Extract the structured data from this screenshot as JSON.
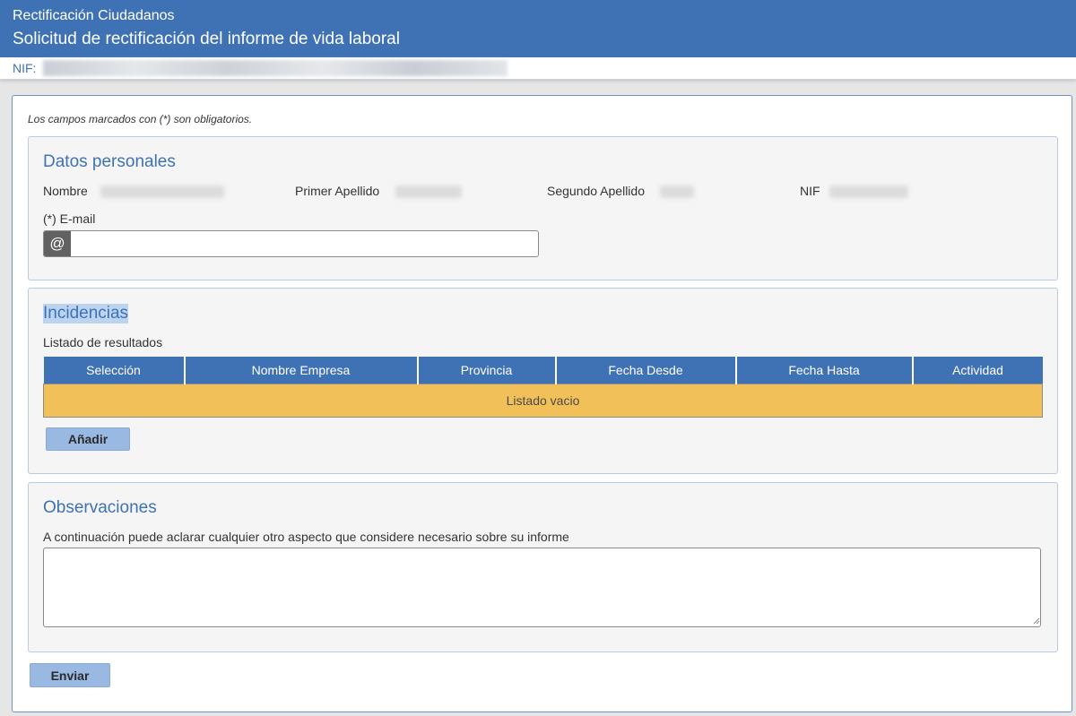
{
  "header": {
    "app_name": "Rectificación Ciudadanos",
    "page_title": "Solicitud de rectificación del informe de vida laboral"
  },
  "nif_bar": {
    "label": "NIF:"
  },
  "required_note": "Los campos marcados con (*) son obligatorios.",
  "personal": {
    "title": "Datos personales",
    "nombre_label": "Nombre",
    "primer_apellido_label": "Primer Apellido",
    "segundo_apellido_label": "Segundo Apellido",
    "nif_label": "NIF",
    "email_label": "(*) E-mail",
    "email_addon": "@",
    "email_value": ""
  },
  "incidencias": {
    "title": "Incidencias",
    "subtitle": "Listado de resultados",
    "columns": [
      "Selección",
      "Nombre Empresa",
      "Provincia",
      "Fecha Desde",
      "Fecha Hasta",
      "Actividad"
    ],
    "empty_message": "Listado vacio",
    "add_button": "Añadir"
  },
  "observaciones": {
    "title": "Observaciones",
    "description": "A continuación puede aclarar cualquier otro aspecto que considere necesario sobre su informe",
    "value": ""
  },
  "submit_button": "Enviar"
}
